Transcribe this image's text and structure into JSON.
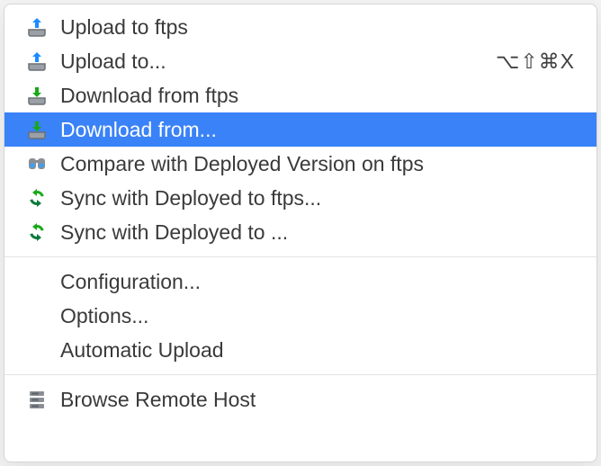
{
  "menu": {
    "items": [
      {
        "label": "Upload to ftps",
        "shortcut": ""
      },
      {
        "label": "Upload to...",
        "shortcut": "⌥⇧⌘X"
      },
      {
        "label": "Download from ftps",
        "shortcut": ""
      },
      {
        "label": "Download from...",
        "shortcut": ""
      },
      {
        "label": "Compare with Deployed Version on ftps",
        "shortcut": ""
      },
      {
        "label": "Sync with Deployed to ftps...",
        "shortcut": ""
      },
      {
        "label": "Sync with Deployed to ...",
        "shortcut": ""
      },
      {
        "label": "Configuration...",
        "shortcut": ""
      },
      {
        "label": "Options...",
        "shortcut": ""
      },
      {
        "label": "Automatic Upload",
        "shortcut": ""
      },
      {
        "label": "Browse Remote Host",
        "shortcut": ""
      }
    ]
  }
}
